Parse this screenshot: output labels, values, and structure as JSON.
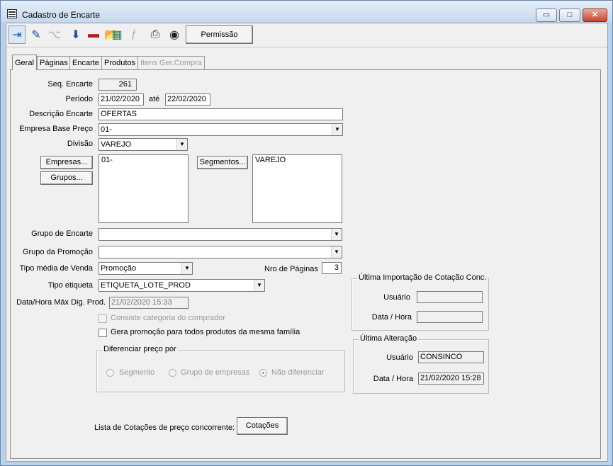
{
  "window": {
    "title": "Cadastro de Encarte",
    "min": "▭",
    "max": "□",
    "close": "✕"
  },
  "toolbar": {
    "icons": [
      "exit-icon",
      "eraser-icon",
      "tree-icon",
      "import-icon",
      "delete-icon",
      "open-folder-icon",
      "grid-icon",
      "fx-icon",
      "print-icon",
      "camera-icon"
    ],
    "glyphs": {
      "exit": "⇥",
      "eraser": "✎",
      "tree": "⌥",
      "import": "⬇",
      "delete": "▬",
      "open": "📂",
      "grid": "▦",
      "fx": "ƒ",
      "print": "⎙",
      "camera": "◉"
    },
    "permissao": "Permissão"
  },
  "tabs": [
    "Geral",
    "Páginas",
    "Encarte",
    "Produtos",
    "Itens Ger.Compra"
  ],
  "form": {
    "seq_label": "Seq. Encarte",
    "seq_value": "261",
    "periodo_label": "Período",
    "periodo_from": "21/02/2020",
    "ate": "até",
    "periodo_to": "22/02/2020",
    "descricao_label": "Descrição Encarte",
    "descricao_value": "OFERTAS",
    "empresa_label": "Empresa Base Preço",
    "empresa_value": "01-",
    "divisao_label": "Divisão",
    "divisao_value": "VAREJO",
    "empresas_btn": "Empresas...",
    "grupos_btn": "Grupos...",
    "empresas_list": [
      "01-"
    ],
    "segmentos_btn": "Segmentos...",
    "segmentos_list": [
      "VAREJO"
    ],
    "grupo_encarte_label": "Grupo de Encarte",
    "grupo_encarte_value": "",
    "grupo_promocao_label": "Grupo da Promoção",
    "grupo_promocao_value": "",
    "tipo_media_label": "Tipo média de Venda",
    "tipo_media_value": "Promoção",
    "nro_paginas_label": "Nro de Páginas",
    "nro_paginas_value": "3",
    "tipo_etiqueta_label": "Tipo etiqueta",
    "tipo_etiqueta_value": "ETIQUETA_LOTE_PROD",
    "datahora_label": "Data/Hora Máx Dig. Prod.",
    "datahora_value": "21/02/2020 15:33",
    "consiste_label": "Consiste categoria do comprador",
    "gera_label": "Gera promoção para todos produtos da mesma família",
    "diferenciar_title": "Diferenciar preço por",
    "radio_segmento": "Segmento",
    "radio_grupo": "Grupo de empresas",
    "radio_nao": "Não diferenciar",
    "cotacoes_label": "Lista de Cotações de preço concorrente:",
    "cotacoes_btn": "Cotações"
  },
  "ultima_importacao": {
    "title": "Última Importação de Cotação Conc.",
    "usuario_label": "Usuário",
    "usuario_value": "",
    "datahora_label": "Data / Hora",
    "datahora_value": ""
  },
  "ultima_alteracao": {
    "title": "Última Alteração",
    "usuario_label": "Usuário",
    "usuario_value": "CONSINCO",
    "datahora_label": "Data / Hora",
    "datahora_value": "21/02/2020 15:28"
  },
  "arrow_glyph": "▼"
}
